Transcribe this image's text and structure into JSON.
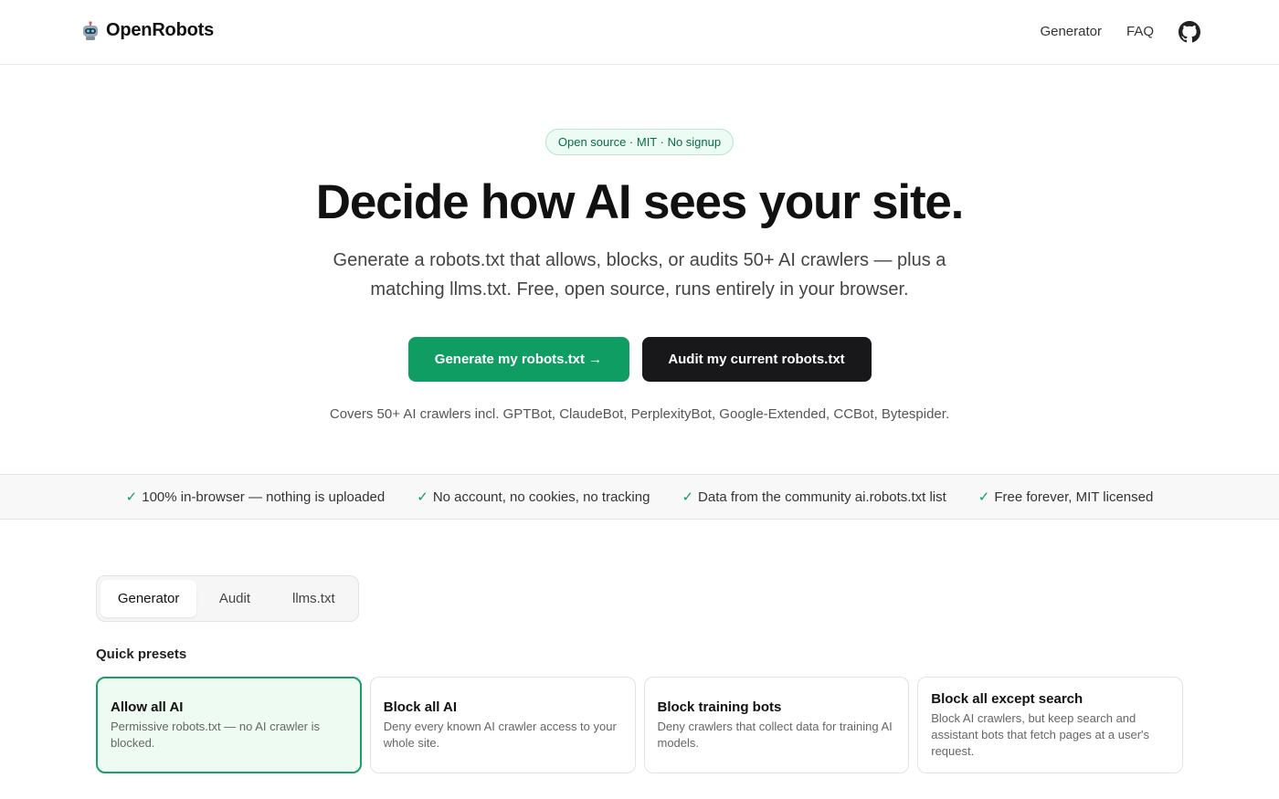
{
  "nav": {
    "brand": "OpenRobots",
    "links": [
      "Generator",
      "FAQ"
    ]
  },
  "hero": {
    "badge": "Open source · MIT · No signup",
    "title": "Decide how AI sees your site.",
    "subtitle": "Generate a robots.txt that allows, blocks, or audits 50+ AI crawlers — plus a matching llms.txt. Free, open source, runs entirely in your browser.",
    "primary_cta": "Generate my robots.txt →",
    "secondary_cta": "Audit my current robots.txt",
    "covers": "Covers 50+ AI crawlers incl. GPTBot, ClaudeBot, PerplexityBot, Google-Extended, CCBot, Bytespider."
  },
  "trust": {
    "check": "✓",
    "items": [
      "100% in-browser — nothing is uploaded",
      "No account, no cookies, no tracking",
      "Data from the community ai.robots.txt list",
      "Free forever, MIT licensed"
    ]
  },
  "tabs": [
    "Generator",
    "Audit",
    "llms.txt"
  ],
  "presets": {
    "label": "Quick presets",
    "items": [
      {
        "title": "Allow all AI",
        "desc": "Permissive robots.txt — no AI crawler is blocked."
      },
      {
        "title": "Block all AI",
        "desc": "Deny every known AI crawler access to your whole site."
      },
      {
        "title": "Block training bots",
        "desc": "Deny crawlers that collect data for training AI models."
      },
      {
        "title": "Block all except search",
        "desc": "Block AI crawlers, but keep search and assistant bots that fetch pages at a user's request."
      }
    ]
  },
  "colors": {
    "accent": "#0f9d63",
    "dark_button": "#18181b",
    "badge_bg": "#ecfbf3"
  }
}
